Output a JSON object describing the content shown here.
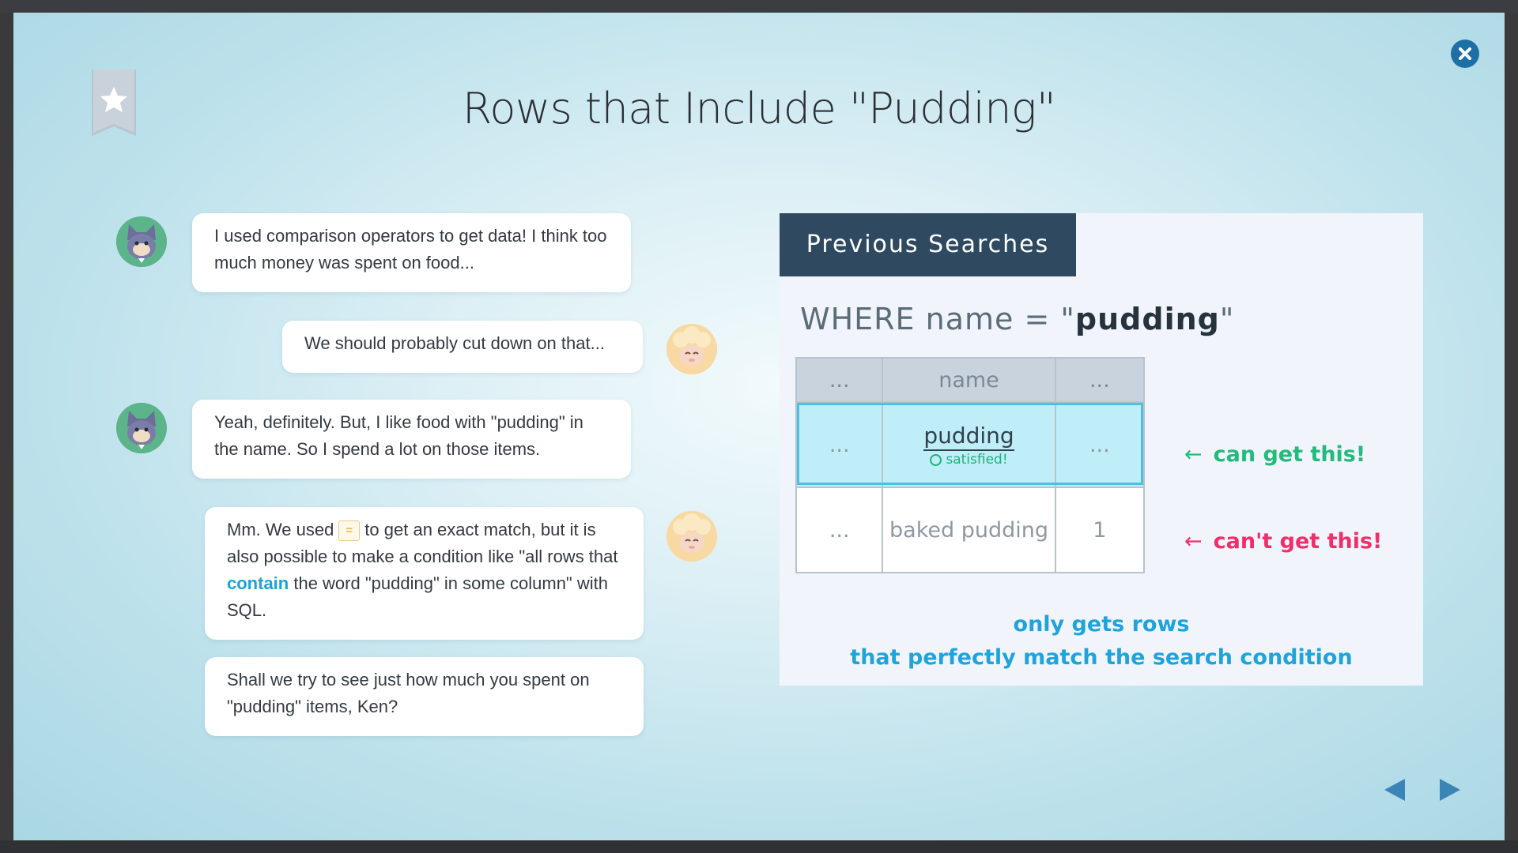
{
  "title": "Rows that Include \"Pudding\"",
  "messages": [
    {
      "speaker": "cat",
      "text": "I used comparison operators to get data! I think too much money was spent on food..."
    },
    {
      "speaker": "sheep",
      "text": "We should probably cut down on that..."
    },
    {
      "speaker": "cat",
      "text": "Yeah, definitely. But, I like food with \"pudding\" in the name. So I spend a lot on those items."
    },
    {
      "speaker": "sheep",
      "parts": {
        "p1": "Mm. We used ",
        "op": "=",
        "p2": " to get an exact match, but it is also possible to make a condition like \"all rows that ",
        "kw": "contain",
        "p3": " the word \"pudding\" in some column\" with SQL."
      }
    },
    {
      "speaker": "sheep",
      "text": "Shall we try to see just how much you spent on \"pudding\" items, Ken?"
    }
  ],
  "panel": {
    "header": "Previous Searches",
    "query_prefix": "WHERE name = \"",
    "query_value": "pudding",
    "query_suffix": "\"",
    "table": {
      "headers": [
        "...",
        "name",
        "..."
      ],
      "row1": [
        "...",
        "pudding",
        "..."
      ],
      "row1_status": "satisfied!",
      "row2": [
        "...",
        "baked pudding",
        "1"
      ]
    },
    "arrow": "←",
    "can_label": "can get this!",
    "cant_label": "can't get this!",
    "note_line1": "only gets rows",
    "note_line2": "that perfectly match the search condition"
  },
  "colors": {
    "accent": "#1fa3dc",
    "success": "#22bb7c",
    "error": "#f02f6a",
    "header_bg": "#2f4a60"
  },
  "icons": {
    "bookmark": "star-bookmark-icon",
    "close": "close-icon",
    "prev": "triangle-left-icon",
    "next": "triangle-right-icon"
  }
}
